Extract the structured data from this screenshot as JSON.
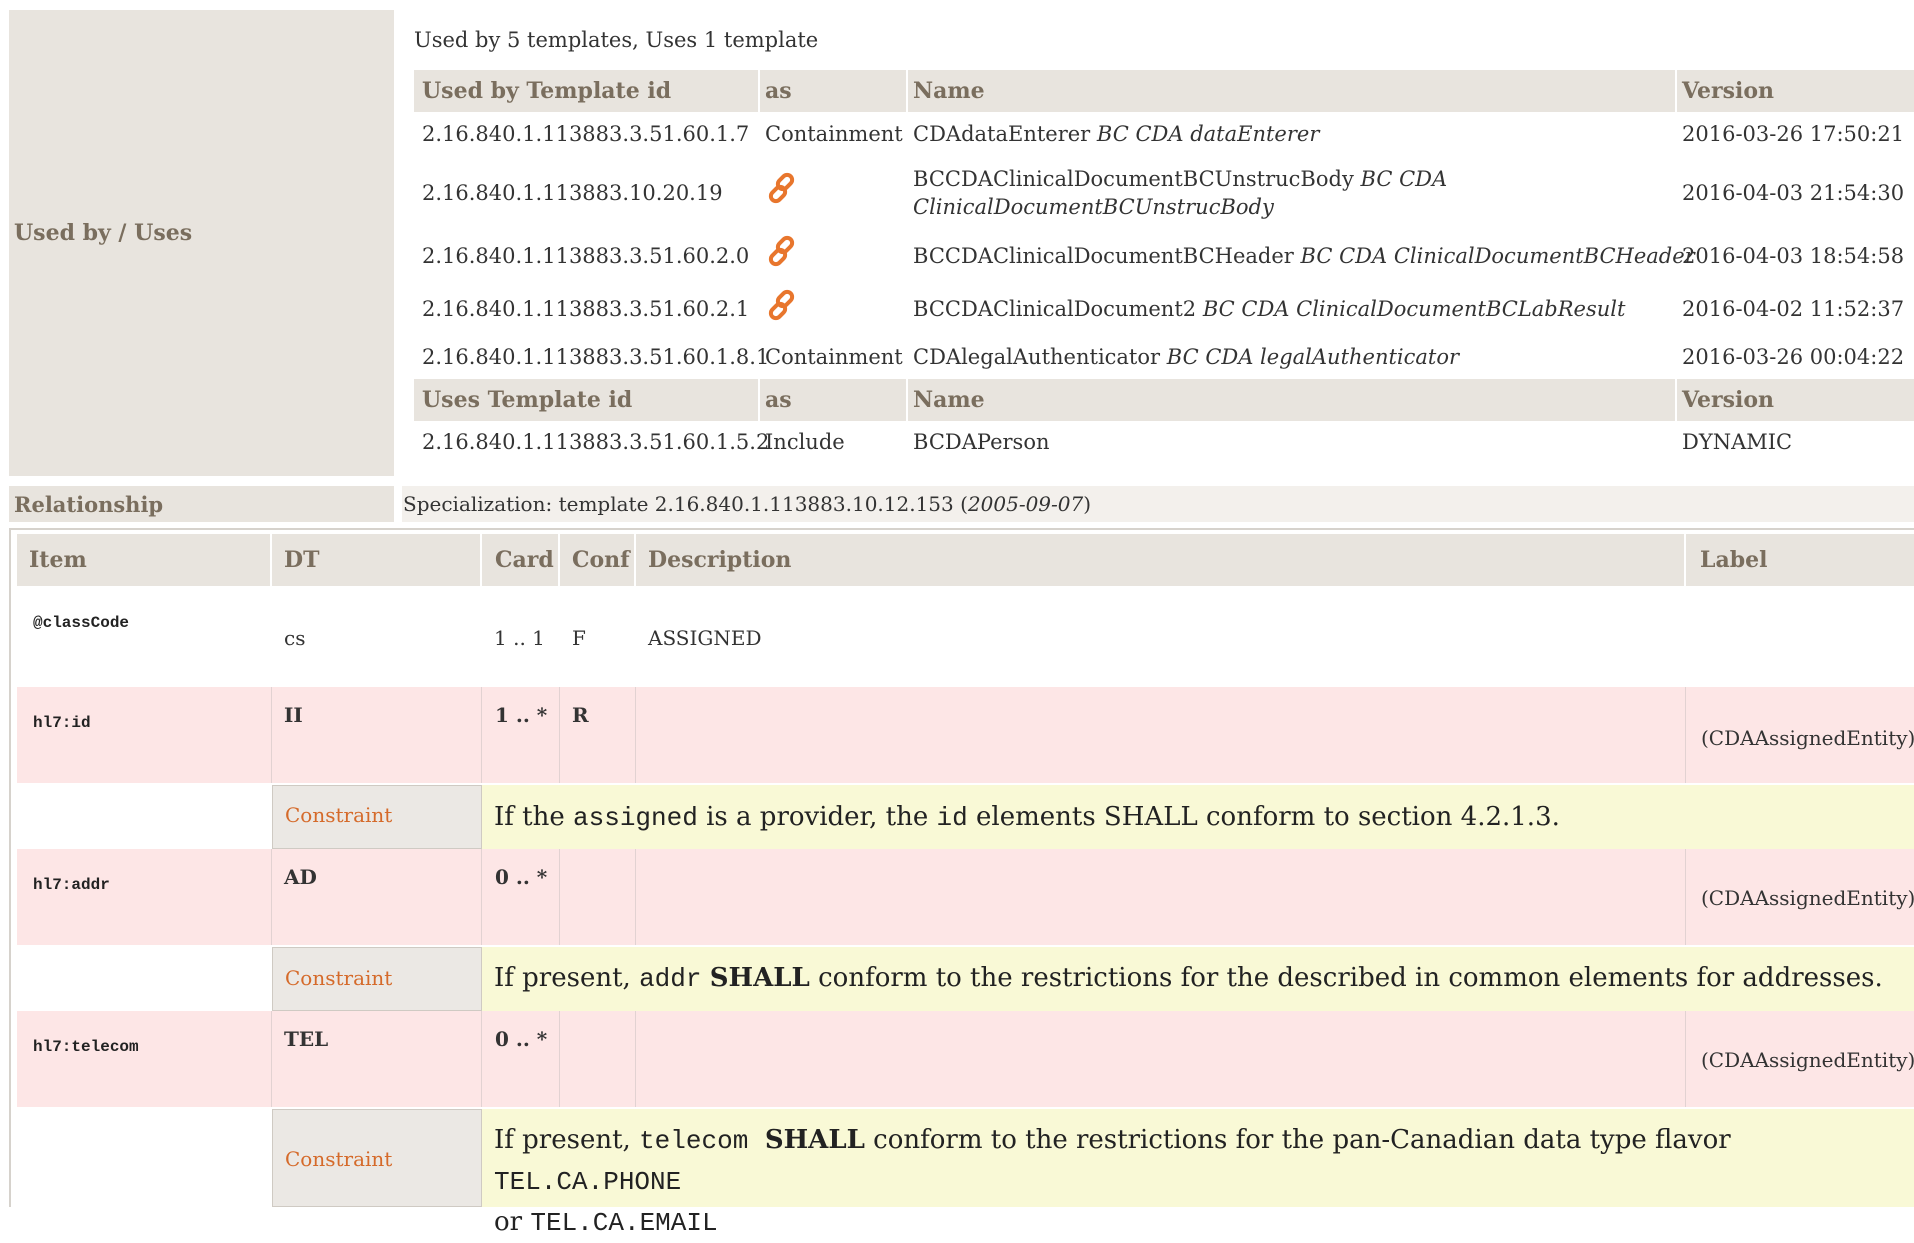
{
  "usedby": {
    "label": "Used by / Uses",
    "summary": "Used by 5 templates, Uses 1 template",
    "used_by_header": {
      "id": "Used by Template id",
      "as": "as",
      "name": "Name",
      "version": "Version"
    },
    "used_by_rows": [
      {
        "id": "2.16.840.1.113883.3.51.60.1.7",
        "as": "Containment",
        "name": "CDAdataEnterer",
        "name_desc": "BC CDA dataEnterer",
        "name_desc2": "",
        "version": "2016-03-26 17:50:21",
        "link_icon": false
      },
      {
        "id": "2.16.840.1.113883.10.20.19",
        "as": "",
        "name": "BCCDAClinicalDocumentBCUnstrucBody",
        "name_desc": "BC CDA",
        "name_desc2": "ClinicalDocumentBCUnstrucBody",
        "version": "2016-04-03 21:54:30",
        "link_icon": true
      },
      {
        "id": "2.16.840.1.113883.3.51.60.2.0",
        "as": "",
        "name": "BCCDAClinicalDocumentBCHeader",
        "name_desc": "BC CDA ClinicalDocumentBCHeader",
        "name_desc2": "",
        "version": "2016-04-03 18:54:58",
        "link_icon": true
      },
      {
        "id": "2.16.840.1.113883.3.51.60.2.1",
        "as": "",
        "name": "BCCDAClinicalDocument2",
        "name_desc": "BC CDA ClinicalDocumentBCLabResult",
        "name_desc2": "",
        "version": "2016-04-02 11:52:37",
        "link_icon": true
      },
      {
        "id": "2.16.840.1.113883.3.51.60.1.8.1",
        "as": "Containment",
        "name": "CDAlegalAuthenticator",
        "name_desc": "BC CDA legalAuthenticator",
        "name_desc2": "",
        "version": "2016-03-26 00:04:22",
        "link_icon": false
      }
    ],
    "uses_header": {
      "id": "Uses Template id",
      "as": "as",
      "name": "Name",
      "version": "Version"
    },
    "uses_rows": [
      {
        "id": "2.16.840.1.113883.3.51.60.1.5.2",
        "as": "Include",
        "name": "BCDAPerson",
        "version": "DYNAMIC"
      }
    ]
  },
  "relationship": {
    "label": "Relationship",
    "text_prefix": "Specialization: template 2.16.840.1.113883.10.12.153 (",
    "date": "2005-09-07",
    "text_suffix": ")"
  },
  "items_table": {
    "headers": {
      "item": "Item",
      "dt": "DT",
      "card": "Card",
      "conf": "Conf",
      "description": "Description",
      "label": "Label"
    },
    "class_code": {
      "item": "@classCode",
      "dt": "cs",
      "card": "1 .. 1",
      "conf": "F",
      "description": "ASSIGNED"
    },
    "id_row": {
      "item": "hl7:id",
      "dt": "II",
      "card": "1 .. *",
      "conf": "R",
      "label": "(CDAAssignedEntity)"
    },
    "id_constraint": {
      "label": "Constraint",
      "t1": "If the ",
      "code1": "assigned",
      "t2": " is a provider, the ",
      "code2": "id",
      "t3": " elements SHALL conform to section 4.2.1.3."
    },
    "addr_row": {
      "item": "hl7:addr",
      "dt": "AD",
      "card": "0 .. *",
      "conf": "",
      "label": "(CDAAssignedEntity)"
    },
    "addr_constraint": {
      "label": "Constraint",
      "t1": "If present, ",
      "code1": "addr",
      "bold1": "SHALL",
      "t2": " conform to the restrictions for the described in common elements for addresses."
    },
    "telecom_row": {
      "item": "hl7:telecom",
      "dt": "TEL",
      "card": "0 .. *",
      "conf": "",
      "label": "(CDAAssignedEntity)"
    },
    "telecom_constraint": {
      "label": "Constraint",
      "t1": "If present, ",
      "code1": "telecom",
      "bold1": "SHALL",
      "t2": " conform to the restrictions for the pan-Canadian data type flavor ",
      "code2": "TEL.CA.PHONE",
      "t3": "or ",
      "code3": "TEL.CA.EMAIL"
    }
  },
  "icons": {
    "link": "link-chain-icon"
  },
  "colors": {
    "header_bg": "#e8e4de",
    "pink_row": "#fde6e6",
    "yellow_row": "#f9f9d6",
    "constraint_label": "#d56a2a",
    "link_icon": "#e8762d"
  }
}
